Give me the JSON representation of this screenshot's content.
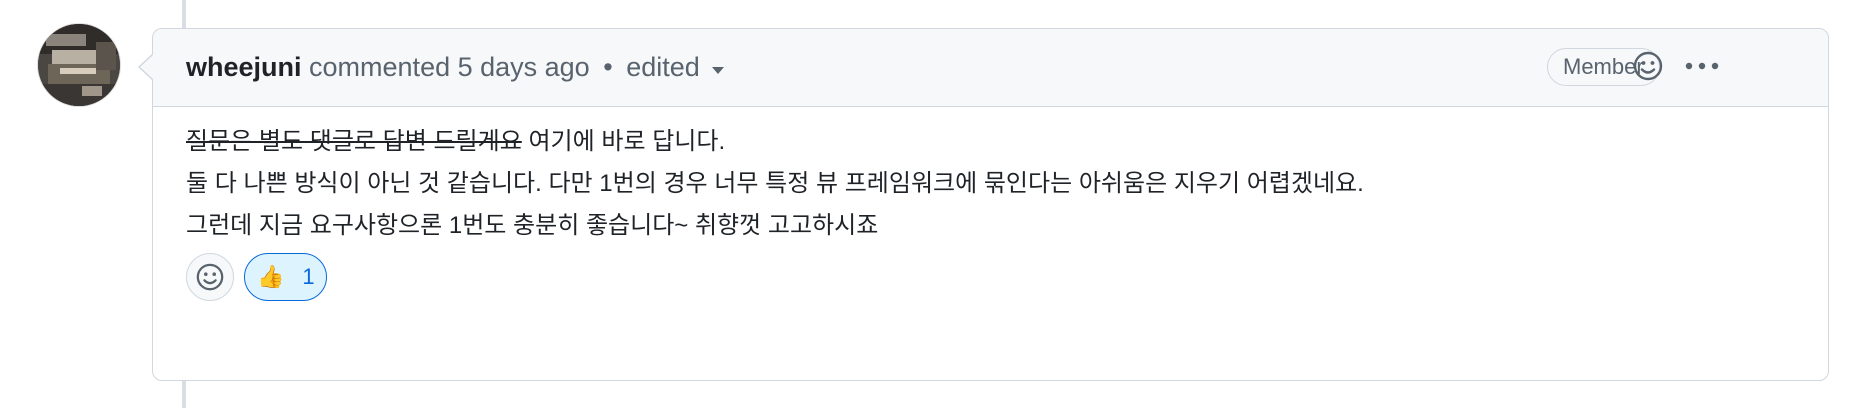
{
  "comment": {
    "author": "wheejuni",
    "action_text": "commented 5 days ago",
    "separator": "•",
    "edited_label": "edited",
    "badge": "Member",
    "body": {
      "line1_strikethrough": "질문은 별도 댓글로 답변 드릴게요",
      "line1_rest": " 여기에 바로 답니다.",
      "line2": "둘 다 나쁜 방식이 아닌 것 같습니다. 다만 1번의 경우 너무 특정 뷰 프레임워크에 묶인다는 아쉬움은 지우기 어렵겠네요.",
      "line3": "그런데 지금 요구사항으론 1번도 충분히 좋습니다~ 취향껏 고고하시죠"
    },
    "reactions": [
      {
        "emoji": "👍",
        "count": "1",
        "icon": "thumbs-up-icon"
      }
    ]
  },
  "icons": {
    "avatar": "user-avatar",
    "edited_menu": "chevron-down-icon",
    "add_reaction_header": "smiley-icon",
    "more_options": "kebab-horizontal-icon",
    "add_reaction_footer": "smiley-icon"
  },
  "colors": {
    "border": "#d0d7de",
    "header_bg": "#f6f8fa",
    "text_primary": "#1f2328",
    "text_muted": "#59636e",
    "reaction_accent": "#0969da",
    "reaction_bg": "#ddf4ff"
  }
}
